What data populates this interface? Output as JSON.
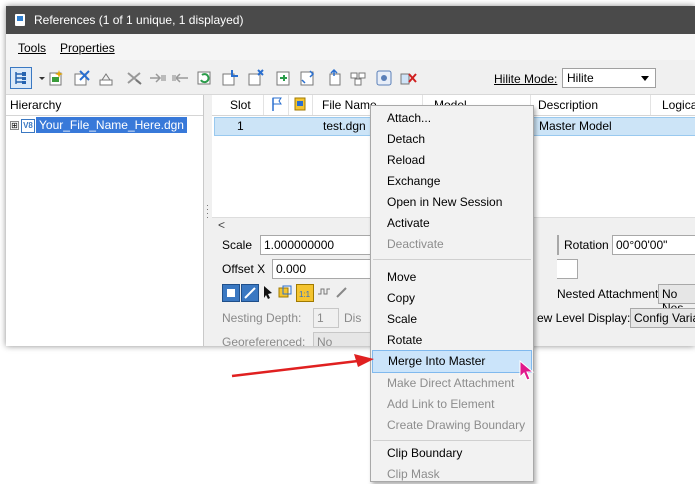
{
  "window": {
    "title": "References (1 of 1 unique, 1 displayed)"
  },
  "menubar": {
    "items": [
      "Tools",
      "Properties"
    ]
  },
  "toolbar": {
    "hilite_label": "Hilite Mode:",
    "hilite_value": "Hilite"
  },
  "hierarchy": {
    "header": "Hierarchy",
    "item_label": "Your_File_Name_Here.dgn",
    "expander": "⊞",
    "icon_text": "V8"
  },
  "table": {
    "columns": [
      "Slot",
      "File Name",
      "Model",
      "Description",
      "Logical"
    ],
    "row": {
      "slot": "1",
      "file_name": "test.dgn",
      "description": "Master Model"
    },
    "scroll_left": "<"
  },
  "properties": {
    "scale_label": "Scale",
    "scale_value": "1.000000000",
    "rotation_label": "Rotation",
    "rotation_value": "00°00'00\"",
    "offset_label": "Offset X",
    "offset_value": "0.000",
    "nested_label": "Nested Attachments:",
    "nested_value": "No Nes",
    "nesting_depth_label": "Nesting Depth:",
    "nesting_depth_value": "1",
    "display_label": "Dis",
    "level_display_label": "ew Level Display:",
    "level_display_value": "Config Varia",
    "georeferenced_label": "Georeferenced:",
    "georeferenced_value": "No"
  },
  "context_menu": {
    "items": [
      {
        "label": "Attach...",
        "enabled": true
      },
      {
        "label": "Detach",
        "enabled": true
      },
      {
        "label": "Reload",
        "enabled": true
      },
      {
        "label": "Exchange",
        "enabled": true
      },
      {
        "label": "Open in New Session",
        "enabled": true
      },
      {
        "label": "Activate",
        "enabled": true
      },
      {
        "label": "Deactivate",
        "enabled": false
      },
      {
        "label": "Move",
        "enabled": true
      },
      {
        "label": "Copy",
        "enabled": true
      },
      {
        "label": "Scale",
        "enabled": true
      },
      {
        "label": "Rotate",
        "enabled": true
      },
      {
        "label": "Merge Into Master",
        "enabled": true,
        "highlighted": true
      },
      {
        "label": "Make Direct Attachment",
        "enabled": false
      },
      {
        "label": "Add Link to Element",
        "enabled": false
      },
      {
        "label": "Create Drawing Boundary",
        "enabled": false
      },
      {
        "label": "Clip Boundary",
        "enabled": true
      },
      {
        "label": "Clip Mask",
        "enabled": false
      }
    ]
  },
  "colors": {
    "titlebar": "#4a4a4a",
    "selection": "#3879d9",
    "row_highlight": "#cce4f7",
    "menu_hover": "#cbe4fa",
    "annotation_arrow": "#e02020",
    "cursor": "#e0188c"
  }
}
